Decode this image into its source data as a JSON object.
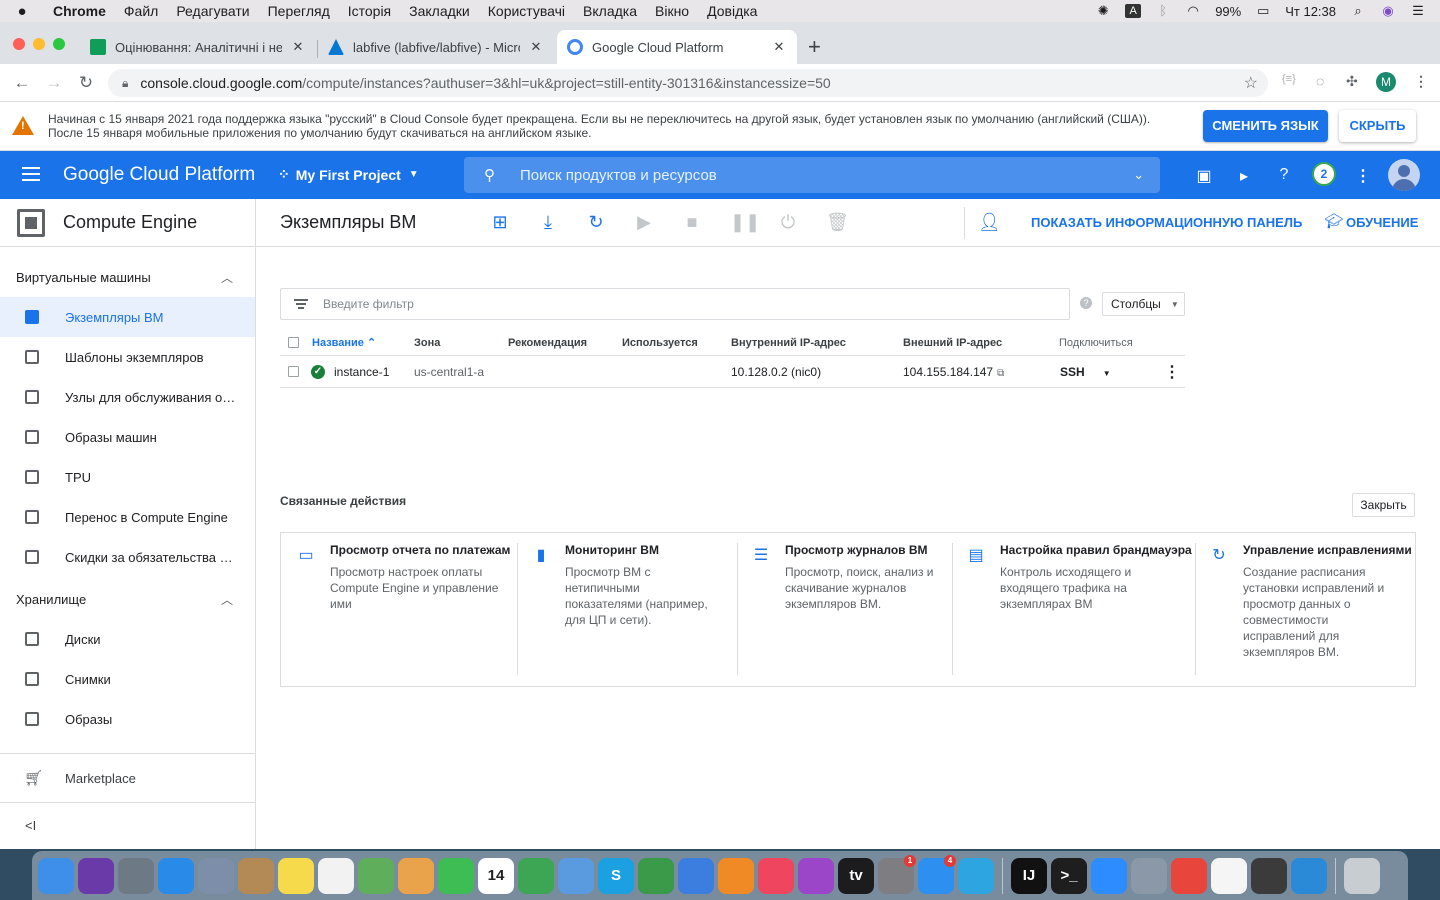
{
  "menubar": {
    "app": "Chrome",
    "items": [
      "Файл",
      "Редагувати",
      "Перегляд",
      "Історія",
      "Закладки",
      "Користувачі",
      "Вкладка",
      "Вікно",
      "Довідка"
    ],
    "input_source": "A",
    "battery": "99%",
    "clock": "Чт 12:38"
  },
  "tabs": [
    {
      "title": "Оцінювання: Аналітичні і нер…",
      "favicon_color": "#0f9d58"
    },
    {
      "title": "labfive (labfive/labfive) - Micro…",
      "favicon_color": "#0078d4"
    },
    {
      "title": "Google Cloud Platform",
      "favicon_color": "#4285f4"
    }
  ],
  "address": {
    "host": "console.cloud.google.com",
    "path": "/compute/instances?authuser=3&hl=uk&project=still-entity-301316&instancessize=50",
    "profile_initial": "M"
  },
  "banner": {
    "line1": "Начиная с 15 января 2021 года поддержка языка \"русский\" в Cloud Console будет прекращена. Если вы не переключитесь на другой язык, будет установлен язык по умолчанию (английский (США)).",
    "line2": "После 15 января мобильные приложения по умолчанию будут скачиваться на английском языке.",
    "change_label": "СМЕНИТЬ ЯЗЫК",
    "hide_label": "СКРЫТЬ"
  },
  "header": {
    "title": "Google Cloud Platform",
    "project": "My First Project",
    "search_placeholder": "Поиск продуктов и ресурсов",
    "notifications": "2"
  },
  "sidebar": {
    "product": "Compute Engine",
    "sections": [
      {
        "title": "Виртуальные машины",
        "items": [
          {
            "label": "Экземпляры ВМ",
            "active": true
          },
          {
            "label": "Шаблоны экземпляров"
          },
          {
            "label": "Узлы для обслуживания о…"
          },
          {
            "label": "Образы машин"
          },
          {
            "label": "TPU"
          },
          {
            "label": "Перенос в Compute Engine"
          },
          {
            "label": "Скидки за обязательства …"
          }
        ]
      },
      {
        "title": "Хранилище",
        "items": [
          {
            "label": "Диски"
          },
          {
            "label": "Снимки"
          },
          {
            "label": "Образы"
          }
        ]
      }
    ],
    "marketplace": "Marketplace",
    "collapse": "<I"
  },
  "actionbar": {
    "title": "Экземпляры ВМ",
    "show_panel": "ПОКАЗАТЬ ИНФОРМАЦИОННУЮ ПАНЕЛЬ",
    "learn": "ОБУЧЕНИЕ"
  },
  "filter": {
    "placeholder": "Введите фильтр",
    "columns_label": "Столбцы"
  },
  "table": {
    "headers": [
      "Название",
      "Зона",
      "Рекомендация",
      "Используется",
      "Внутренний IP-адрес",
      "Внешний IP-адрес",
      "Подключиться"
    ],
    "rows": [
      {
        "name": "instance-1",
        "zone": "us-central1-a",
        "recommendation": "",
        "in_use": "",
        "internal_ip": "10.128.0.2 (nic0)",
        "external_ip": "104.155.184.147",
        "connect": "SSH",
        "status": "running"
      }
    ]
  },
  "related": {
    "title": "Связанные действия",
    "close_label": "Закрыть",
    "cards": [
      {
        "icon": "credit-card-icon",
        "title": "Просмотр отчета по платежам",
        "desc": "Просмотр настроек оплаты Compute Engine и управление ими"
      },
      {
        "icon": "bar-chart-icon",
        "title": "Мониторинг ВМ",
        "desc": "Просмотр ВМ с нетипичными показателями (например, для ЦП и сети)."
      },
      {
        "icon": "list-icon",
        "title": "Просмотр журналов ВМ",
        "desc": "Просмотр, поиск, анализ и скачивание журналов экземпляров ВМ."
      },
      {
        "icon": "firewall-icon",
        "title": "Настройка правил брандмауэра",
        "desc": "Контроль исходящего и входящего трафика на экземплярах ВМ"
      },
      {
        "icon": "patch-icon",
        "title": "Управление исправлениями",
        "desc": "Создание расписания установки исправлений и просмотр данных о совместимости исправлений для экземпляров ВМ."
      }
    ]
  },
  "dock": {
    "apps": [
      {
        "name": "finder",
        "color": "#3d8fe8"
      },
      {
        "name": "siri",
        "color": "#6a3ba8"
      },
      {
        "name": "launchpad",
        "color": "#6d7a86"
      },
      {
        "name": "safari",
        "color": "#2a8ae8"
      },
      {
        "name": "preview",
        "color": "#7d8fa8"
      },
      {
        "name": "contacts",
        "color": "#b38a56"
      },
      {
        "name": "notes",
        "color": "#f7d94c"
      },
      {
        "name": "reminders",
        "color": "#f2f2f2"
      },
      {
        "name": "maps",
        "color": "#5fae5c"
      },
      {
        "name": "photos",
        "color": "#e9a34a"
      },
      {
        "name": "messages",
        "color": "#3fbd55"
      },
      {
        "name": "calendar",
        "color": "#ffffff",
        "text": "14"
      },
      {
        "name": "facetime",
        "color": "#3ca655"
      },
      {
        "name": "mail",
        "color": "#5a9be0"
      },
      {
        "name": "skype",
        "color": "#1ba0e1",
        "text": "S"
      },
      {
        "name": "numbers",
        "color": "#3a9a4a"
      },
      {
        "name": "keynote",
        "color": "#3c7ee0"
      },
      {
        "name": "books",
        "color": "#f08a24"
      },
      {
        "name": "music",
        "color": "#f0455e"
      },
      {
        "name": "podcasts",
        "color": "#9b45c9"
      },
      {
        "name": "tv",
        "color": "#1c1c1e",
        "text": "tv"
      },
      {
        "name": "system-preferences",
        "color": "#7d7d82",
        "badge": "1"
      },
      {
        "name": "app-store",
        "color": "#2d8ff0",
        "badge": "4"
      },
      {
        "name": "telegram",
        "color": "#2ca5e0"
      },
      {
        "name": "intellij",
        "color": "#111111",
        "text": "IJ"
      },
      {
        "name": "terminal",
        "color": "#1e1e1e",
        "text": ">_"
      },
      {
        "name": "zoom",
        "color": "#2d8cff"
      },
      {
        "name": "screenshot",
        "color": "#8a98a8"
      },
      {
        "name": "chrome",
        "color": "#e8453c"
      },
      {
        "name": "slack",
        "color": "#f5f5f5"
      },
      {
        "name": "sublime",
        "color": "#3b3b3b"
      },
      {
        "name": "vscode",
        "color": "#2a8ad8"
      },
      {
        "name": "trash",
        "color": "#c8cdd2"
      }
    ]
  }
}
